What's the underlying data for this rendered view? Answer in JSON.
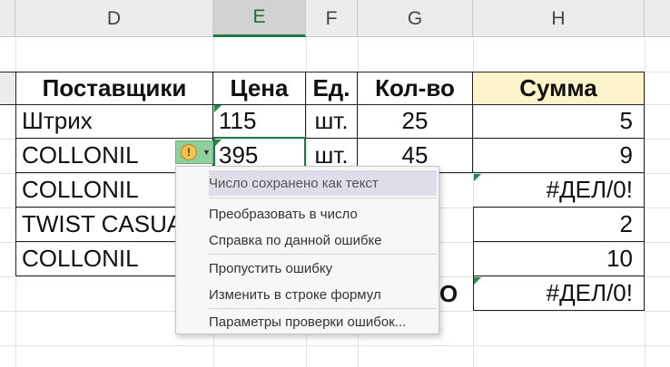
{
  "columns": [
    "D",
    "E",
    "F",
    "G",
    "H"
  ],
  "table": {
    "headers": [
      "Поставщики",
      "Цена",
      "Ед.",
      "Кол-во",
      "Сумма"
    ],
    "rows": [
      {
        "supplier": "Штрих",
        "price": "115",
        "unit": "шт.",
        "qty": "25",
        "sum": "5"
      },
      {
        "supplier": "COLLONIL",
        "price": "395",
        "unit": "шт.",
        "qty": "45",
        "sum": "9"
      },
      {
        "supplier": "COLLONIL",
        "price": "",
        "unit": "",
        "qty": "",
        "sum": "#ДЕЛ/0!"
      },
      {
        "supplier": "TWIST CASUAL",
        "price": "",
        "unit": "",
        "qty": "",
        "sum": "2"
      },
      {
        "supplier": "COLLONIL",
        "price": "",
        "unit": "",
        "qty": "",
        "sum": "10"
      }
    ],
    "total_partial": "О",
    "total_sum": "#ДЕЛ/0!"
  },
  "error_menu": {
    "title": "Число сохранено как текст",
    "items": [
      "Преобразовать в число",
      "Справка по данной ошибке",
      "Пропустить ошибку",
      "Изменить в строке формул",
      "Параметры проверки ошибок..."
    ]
  },
  "icons": {
    "error": "warning-exclamation-icon",
    "dropdown": "dropdown-arrow-icon"
  },
  "colors": {
    "accent": "#1f7a45",
    "sum_header_bg": "#fff3cc",
    "error_button_bg": "#8fcf9c"
  }
}
